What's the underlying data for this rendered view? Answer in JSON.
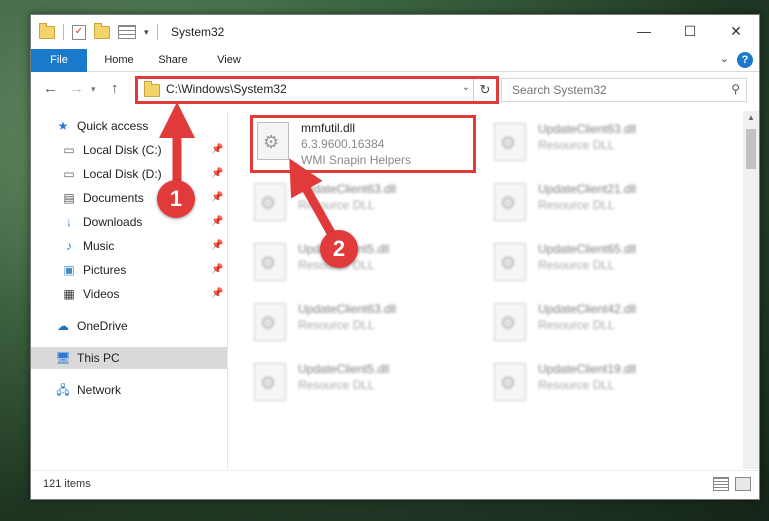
{
  "window": {
    "title": "System32",
    "controls": [
      "minimize",
      "maximize",
      "close"
    ]
  },
  "ribbon": {
    "tabs": [
      "File",
      "Home",
      "Share",
      "View"
    ],
    "help_label": "?"
  },
  "nav": {
    "address": "C:\\Windows\\System32",
    "search_placeholder": "Search System32"
  },
  "sidebar": {
    "items": [
      {
        "label": "Quick access",
        "icon": "star-icon",
        "pinned": false
      },
      {
        "label": "Local Disk (C:)",
        "icon": "drive-icon",
        "pinned": true
      },
      {
        "label": "Local Disk (D:)",
        "icon": "drive-icon",
        "pinned": true
      },
      {
        "label": "Documents",
        "icon": "documents-icon",
        "pinned": true
      },
      {
        "label": "Downloads",
        "icon": "download-icon",
        "pinned": true
      },
      {
        "label": "Music",
        "icon": "music-icon",
        "pinned": true
      },
      {
        "label": "Pictures",
        "icon": "pictures-icon",
        "pinned": true
      },
      {
        "label": "Videos",
        "icon": "videos-icon",
        "pinned": true
      },
      {
        "label": "OneDrive",
        "icon": "cloud-icon",
        "pinned": false
      },
      {
        "label": "This PC",
        "icon": "computer-icon",
        "pinned": false,
        "selected": true
      },
      {
        "label": "Network",
        "icon": "network-icon",
        "pinned": false
      }
    ]
  },
  "files": [
    {
      "name": "mmfutil.dll",
      "line2": "6.3.9600.16384",
      "line3": "WMI Snapin Helpers",
      "highlighted": true
    },
    {
      "name": "UpdateClient63.dll",
      "line2": "Resource DLL"
    },
    {
      "name": "UpdateClient63.dll",
      "line2": "Resource DLL"
    },
    {
      "name": "UpdateClient21.dll",
      "line2": "Resource DLL"
    },
    {
      "name": "UpdateClient5.dll",
      "line2": "Resource DLL"
    },
    {
      "name": "UpdateClient65.dll",
      "line2": "Resource DLL"
    },
    {
      "name": "UpdateClient63.dll",
      "line2": "Resource DLL"
    },
    {
      "name": "UpdateClient42.dll",
      "line2": "Resource DLL"
    },
    {
      "name": "UpdateClient5.dll",
      "line2": "Resource DLL"
    },
    {
      "name": "UpdateClient19.dll",
      "line2": "Resource DLL"
    }
  ],
  "status": {
    "item_count": "121 items"
  },
  "annotations": {
    "step1": "1",
    "step2": "2",
    "color": "#e03a3a"
  }
}
